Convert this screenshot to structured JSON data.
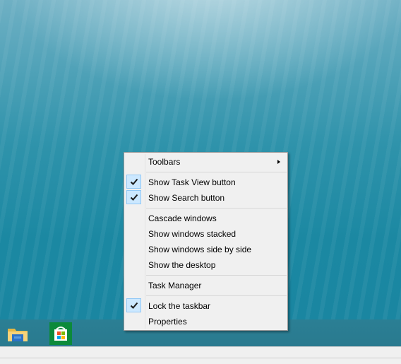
{
  "taskbar": {
    "icons": [
      {
        "name": "file-explorer-icon"
      },
      {
        "name": "store-icon"
      }
    ]
  },
  "context_menu": {
    "toolbars": "Toolbars",
    "show_task_view": "Show Task View button",
    "show_search": "Show Search button",
    "cascade": "Cascade windows",
    "stacked": "Show windows stacked",
    "side_by_side": "Show windows side by side",
    "show_desktop": "Show the desktop",
    "task_manager": "Task Manager",
    "lock_taskbar": "Lock the taskbar",
    "properties": "Properties"
  },
  "colors": {
    "check_bg": "#cce8ff",
    "check_border": "#90c8f6",
    "store_green": "#0c8a3a"
  }
}
